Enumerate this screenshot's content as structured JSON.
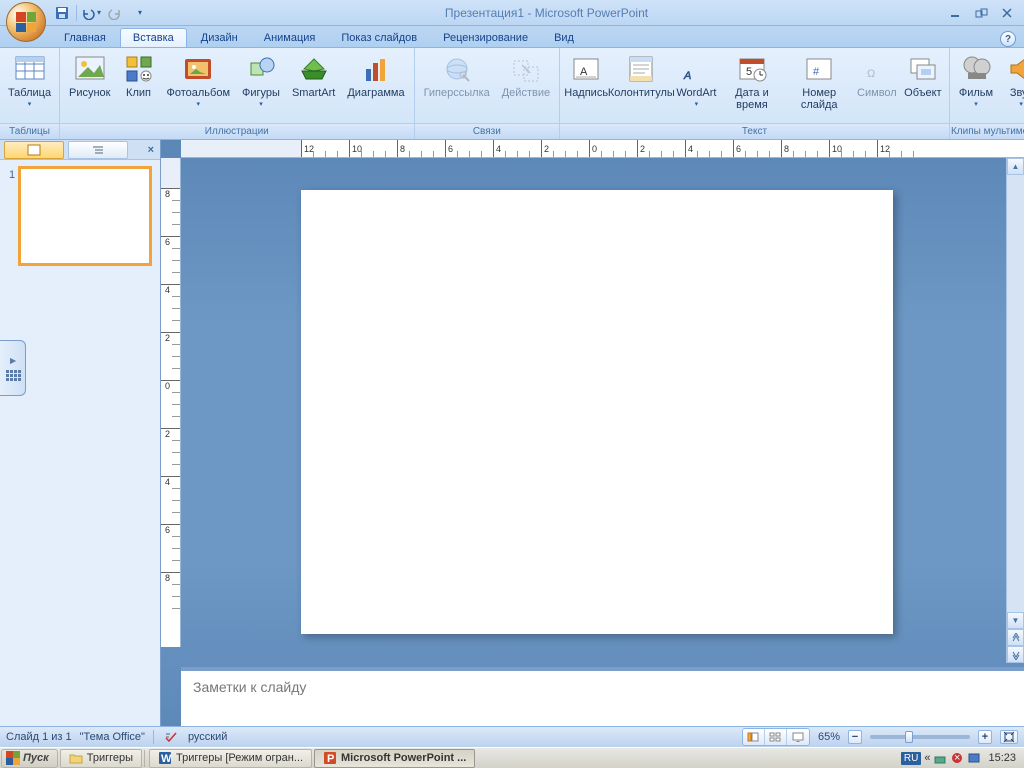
{
  "title": "Презентация1 - Microsoft PowerPoint",
  "tabs": {
    "home": "Главная",
    "insert": "Вставка",
    "design": "Дизайн",
    "animation": "Анимация",
    "slideshow": "Показ слайдов",
    "review": "Рецензирование",
    "view": "Вид"
  },
  "ribbon": {
    "tables": {
      "label": "Таблицы",
      "table": "Таблица"
    },
    "illustrations": {
      "label": "Иллюстрации",
      "picture": "Рисунок",
      "clip": "Клип",
      "photoalbum": "Фотоальбом",
      "shapes": "Фигуры",
      "smartart": "SmartArt",
      "chart": "Диаграмма"
    },
    "links": {
      "label": "Связи",
      "hyperlink": "Гиперссылка",
      "action": "Действие"
    },
    "text": {
      "label": "Текст",
      "textbox": "Надпись",
      "headerfooter": "Колонтитулы",
      "wordart": "WordArt",
      "datetime": "Дата и время",
      "slidenumber": "Номер слайда",
      "symbol": "Символ",
      "object": "Объект"
    },
    "media": {
      "label": "Клипы мультимедиа",
      "movie": "Фильм",
      "sound": "Звук"
    }
  },
  "outline": {
    "slide_num": "1"
  },
  "notes_placeholder": "Заметки к слайду",
  "status": {
    "slide_info": "Слайд 1 из 1",
    "theme": "\"Тема Office\"",
    "language": "русский",
    "zoom": "65%"
  },
  "taskbar": {
    "start": "Пуск",
    "folder": "Триггеры",
    "word": "Триггеры [Режим огран...",
    "ppt": "Microsoft PowerPoint ...",
    "lang": "RU",
    "chevron": "«",
    "time": "15:23"
  },
  "hruler_ticks": [
    12,
    10,
    8,
    6,
    4,
    2,
    0,
    2,
    4,
    6,
    8,
    10,
    12
  ],
  "vruler_ticks": [
    8,
    6,
    4,
    2,
    0,
    2,
    4,
    6,
    8
  ]
}
